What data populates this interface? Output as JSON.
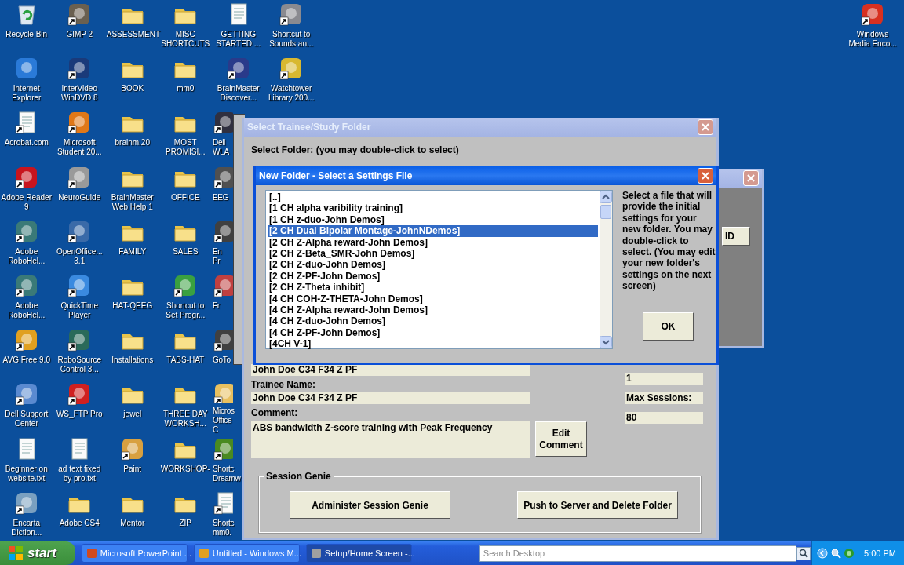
{
  "desktop_icons": [
    {
      "label": "Recycle Bin",
      "kind": "recycle",
      "shortcut": false
    },
    {
      "label": "Internet Explorer",
      "kind": "app",
      "color": "#2a7ad8",
      "shortcut": false
    },
    {
      "label": "Acrobat.com",
      "kind": "document",
      "shortcut": true
    },
    {
      "label": "Adobe Reader 9",
      "kind": "app",
      "color": "#c8141e",
      "shortcut": true
    },
    {
      "label": "Adobe RoboHel...",
      "kind": "app",
      "color": "#3a7a78",
      "shortcut": true
    },
    {
      "label": "Adobe RoboHel...",
      "kind": "app",
      "color": "#3a7a78",
      "shortcut": true
    },
    {
      "label": "AVG Free 9.0",
      "kind": "app",
      "color": "#e0a020",
      "shortcut": true
    },
    {
      "label": "Dell Support Center",
      "kind": "app",
      "color": "#5a8ad0",
      "shortcut": true
    },
    {
      "label": "Beginner on website.txt",
      "kind": "document",
      "shortcut": false
    },
    {
      "label": "Encarta Diction...",
      "kind": "app",
      "color": "#7aa0c0",
      "shortcut": true
    },
    {
      "label": "GIMP 2",
      "kind": "app",
      "color": "#6a6050",
      "shortcut": true
    },
    {
      "label": "InterVideo WinDVD 8",
      "kind": "app",
      "color": "#1a3a7a",
      "shortcut": true
    },
    {
      "label": "Microsoft Student 20...",
      "kind": "app",
      "color": "#e07818",
      "shortcut": true
    },
    {
      "label": "NeuroGuide",
      "kind": "app",
      "color": "#9a9a9a",
      "shortcut": true
    },
    {
      "label": "OpenOffice... 3.1",
      "kind": "app",
      "color": "#3a6aa8",
      "shortcut": true
    },
    {
      "label": "QuickTime Player",
      "kind": "app",
      "color": "#3a8ae0",
      "shortcut": true
    },
    {
      "label": "RoboSource Control 3...",
      "kind": "app",
      "color": "#2a6a5a",
      "shortcut": true
    },
    {
      "label": "WS_FTP Pro",
      "kind": "app",
      "color": "#d02020",
      "shortcut": true
    },
    {
      "label": "ad text fixed by pro.txt",
      "kind": "document",
      "shortcut": false
    },
    {
      "label": "Adobe CS4",
      "kind": "folder",
      "shortcut": false
    },
    {
      "label": "ASSESSMENT",
      "kind": "folder",
      "shortcut": false
    },
    {
      "label": "BOOK",
      "kind": "folder",
      "shortcut": false
    },
    {
      "label": "brainm.20",
      "kind": "folder",
      "shortcut": false
    },
    {
      "label": "BrainMaster Web Help 1",
      "kind": "folder",
      "shortcut": false
    },
    {
      "label": "FAMILY",
      "kind": "folder",
      "shortcut": false
    },
    {
      "label": "HAT-QEEG",
      "kind": "folder",
      "shortcut": false
    },
    {
      "label": "Installations",
      "kind": "folder",
      "shortcut": false
    },
    {
      "label": "jewel",
      "kind": "folder",
      "shortcut": false
    },
    {
      "label": "Paint",
      "kind": "app",
      "color": "#d8a040",
      "shortcut": true
    },
    {
      "label": "Mentor",
      "kind": "folder",
      "shortcut": false
    },
    {
      "label": "MISC SHORTCUTS",
      "kind": "folder",
      "shortcut": false
    },
    {
      "label": "mm0",
      "kind": "folder",
      "shortcut": false
    },
    {
      "label": "MOST PROMISI...",
      "kind": "folder",
      "shortcut": false
    },
    {
      "label": "OFFICE",
      "kind": "folder",
      "shortcut": false
    },
    {
      "label": "SALES",
      "kind": "folder",
      "shortcut": false
    },
    {
      "label": "Shortcut to Set Progr...",
      "kind": "app",
      "color": "#3aa040",
      "shortcut": true
    },
    {
      "label": "TABS-HAT",
      "kind": "folder",
      "shortcut": false
    },
    {
      "label": "THREE DAY WORKSH...",
      "kind": "folder",
      "shortcut": false
    },
    {
      "label": "WORKSHOP-",
      "kind": "folder",
      "shortcut": false
    },
    {
      "label": "ZIP",
      "kind": "folder",
      "shortcut": false
    },
    {
      "label": "GETTING STARTED ...",
      "kind": "document",
      "shortcut": false
    },
    {
      "label": "BrainMaster Discover...",
      "kind": "app",
      "color": "#2a3a8a",
      "shortcut": true
    },
    {
      "label": "Dell WLA",
      "kind": "app",
      "color": "#303040",
      "shortcut": true,
      "cut": true
    },
    {
      "label": "EEG",
      "kind": "app",
      "color": "#505050",
      "shortcut": true,
      "cut": true
    },
    {
      "label": "En Pr",
      "kind": "app",
      "color": "#404040",
      "shortcut": true,
      "cut": true
    },
    {
      "label": "Fr",
      "kind": "app",
      "color": "#c04040",
      "shortcut": true,
      "cut": true
    },
    {
      "label": "GoTo",
      "kind": "app",
      "color": "#404040",
      "shortcut": true,
      "cut": true
    },
    {
      "label": "Micros Office C",
      "kind": "app",
      "color": "#e8c060",
      "shortcut": true,
      "cut": true
    },
    {
      "label": "Shortc Dreamw",
      "kind": "app",
      "color": "#4a8a20",
      "shortcut": true,
      "cut": true
    },
    {
      "label": "Shortc mm0.",
      "kind": "document",
      "shortcut": true,
      "cut": true
    },
    {
      "label": "Shortcut to Sounds an...",
      "kind": "app",
      "color": "#8a8a90",
      "shortcut": true
    },
    {
      "label": "Watchtower Library 200...",
      "kind": "app",
      "color": "#d8b830",
      "shortcut": true
    }
  ],
  "corner_icon": {
    "label": "Windows Media Enco...",
    "kind": "app",
    "color": "#d83020",
    "shortcut": true
  },
  "folder_dialog": {
    "title": "Select Trainee/Study Folder",
    "prompt": "Select Folder: (you may double-click to select)",
    "folder_value": "John Doe C34 F34 Z PF",
    "trainee_label": "Trainee Name:",
    "trainee_value": "John Doe C34 F34 Z PF",
    "comment_label": "Comment:",
    "comment_value": "ABS bandwidth Z-score training with Peak Frequency",
    "edit_button": "Edit Comment",
    "session_value": "1",
    "max_label": "Max Sessions:",
    "max_value": "80",
    "genie_title": "Session Genie",
    "genie_buttons": [
      "Administer Session Genie",
      "Push to Server and Delete Folder"
    ]
  },
  "side_window": {
    "button": "ID"
  },
  "settings_dialog": {
    "title": "New Folder - Select a Settings File",
    "files": [
      {
        "name": "[..]",
        "selected": false
      },
      {
        "name": "[1 CH alpha varibility training]",
        "selected": false
      },
      {
        "name": "[1 CH z-duo-John Demos]",
        "selected": false
      },
      {
        "name": "[2 CH Dual Bipolar Montage-JohnNDemos]",
        "selected": true
      },
      {
        "name": "[2 CH Z-Alpha reward-John Demos]",
        "selected": false
      },
      {
        "name": "[2 CH Z-Beta_SMR-John Demos]",
        "selected": false
      },
      {
        "name": "[2 CH Z-duo-John Demos]",
        "selected": false
      },
      {
        "name": "[2 CH Z-PF-John Demos]",
        "selected": false
      },
      {
        "name": "[2 CH Z-Theta inhibit]",
        "selected": false
      },
      {
        "name": "[4 CH COH-Z-THETA-John Demos]",
        "selected": false
      },
      {
        "name": "[4 CH Z-Alpha reward-John Demos]",
        "selected": false
      },
      {
        "name": "[4 CH Z-duo-John Demos]",
        "selected": false
      },
      {
        "name": "[4 CH Z-PF-John Demos]",
        "selected": false
      },
      {
        "name": "[4CH V-1]",
        "selected": false
      }
    ],
    "help": "Select a file that will provide the initial settings for your new folder. You may double-click to select. (You may edit your new folder's settings on the next screen)",
    "ok": "OK"
  },
  "taskbar": {
    "start": "start",
    "tasks": [
      {
        "label": "Microsoft PowerPoint ...",
        "selected": false,
        "color": "#d04a20"
      },
      {
        "label": "Untitled - Windows M...",
        "selected": false,
        "color": "#e0a020"
      },
      {
        "label": "Setup/Home Screen -...",
        "selected": true,
        "color": "#a0a0a0"
      }
    ],
    "search": {
      "placeholder": "Search Desktop"
    },
    "clock": "5:00 PM"
  }
}
